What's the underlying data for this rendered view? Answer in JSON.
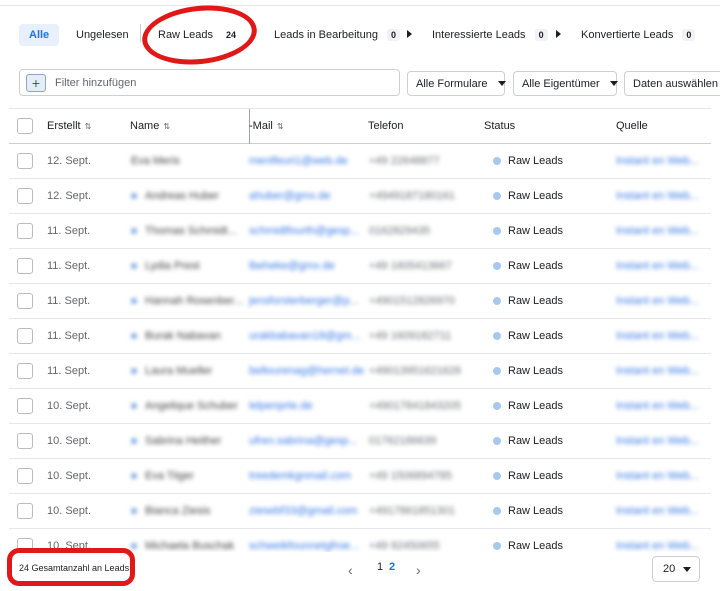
{
  "tabs": [
    {
      "label": "Alle",
      "active": true
    },
    {
      "label": "Ungelesen"
    },
    {
      "label": "Raw Leads",
      "count": "24"
    },
    {
      "label": "Leads in Bearbeitung",
      "count": "0"
    },
    {
      "label": "Interessierte Leads",
      "count": "0"
    },
    {
      "label": "Konvertierte Leads",
      "count": "0"
    }
  ],
  "filter": {
    "add_icon": "+",
    "placeholder": "Filter hinzufügen",
    "forms_label": "Alle Formulare",
    "owners_label": "Alle Eigentümer",
    "data_label": "Daten auswählen"
  },
  "table": {
    "headers": {
      "created": "Erstellt",
      "name": "Name",
      "email": "-Mail",
      "phone": "Telefon",
      "status": "Status",
      "source": "Quelle"
    },
    "sort_icon": "⇅",
    "rows": [
      {
        "date": "12. Sept.",
        "name": "Eva Meris",
        "email": "mentfeuri1@web.de",
        "phone": "+49 22648877",
        "status": "Raw Leads",
        "source": "Instant en Web..."
      },
      {
        "date": "12. Sept.",
        "name": "Andreas Huber",
        "email": "ahuber@gmx.de",
        "phone": "+4949187180161",
        "status": "Raw Leads",
        "source": "Instant en Web..."
      },
      {
        "date": "11. Sept.",
        "name": "Thomas Schmidt...",
        "email": "schmidtfourth@gesp...",
        "phone": "0162829435",
        "status": "Raw Leads",
        "source": "Instant en Web..."
      },
      {
        "date": "11. Sept.",
        "name": "Lydia Prest",
        "email": "lbeheke@gmx.de",
        "phone": "+49 1605413667",
        "status": "Raw Leads",
        "source": "Instant en Web..."
      },
      {
        "date": "11. Sept.",
        "name": "Hannah Rosenber...",
        "email": "jensforsterberger@p...",
        "phone": "+4901512826970",
        "status": "Raw Leads",
        "source": "Instant en Web..."
      },
      {
        "date": "11. Sept.",
        "name": "Burak Nabavan",
        "email": "urakbabavan18@gm...",
        "phone": "+49 1609182711",
        "status": "Raw Leads",
        "source": "Instant en Web..."
      },
      {
        "date": "11. Sept.",
        "name": "Laura Mueller",
        "email": "bellourenag@hernet.de",
        "phone": "+49013951621626",
        "status": "Raw Leads",
        "source": "Instant en Web..."
      },
      {
        "date": "10. Sept.",
        "name": "Angelique Schuber",
        "email": "lelpenprte.de",
        "phone": "+49017841843205",
        "status": "Raw Leads",
        "source": "Instant en Web..."
      },
      {
        "date": "10. Sept.",
        "name": "Sabrina Heither",
        "email": "ufren.sabrina@gesp...",
        "phone": "01762186639",
        "status": "Raw Leads",
        "source": "Instant en Web..."
      },
      {
        "date": "10. Sept.",
        "name": "Eva Tiiger",
        "email": "treedemkgnmail.com",
        "phone": "+49 1506894785",
        "status": "Raw Leads",
        "source": "Instant en Web..."
      },
      {
        "date": "10. Sept.",
        "name": "Bianca Ziesis",
        "email": "ziesebf33@gmail.com",
        "phone": "+4917861851301",
        "status": "Raw Leads",
        "source": "Instant en Web..."
      },
      {
        "date": "10. Sept.",
        "name": "Michaela Buschak",
        "email": "schweikfounnetgfroe...",
        "phone": "+49 92450655",
        "status": "Raw Leads",
        "source": "Instant en Web..."
      }
    ]
  },
  "footer": {
    "total": "24 Gesamtanzahl an Leads",
    "prev_icon": "‹",
    "next_icon": "›",
    "pages": [
      "1",
      "2"
    ],
    "per_page": "20"
  },
  "colors": {
    "accent": "#1a73e8",
    "annotation_red": "#e01818",
    "status_dot": "#a8c9ee"
  }
}
